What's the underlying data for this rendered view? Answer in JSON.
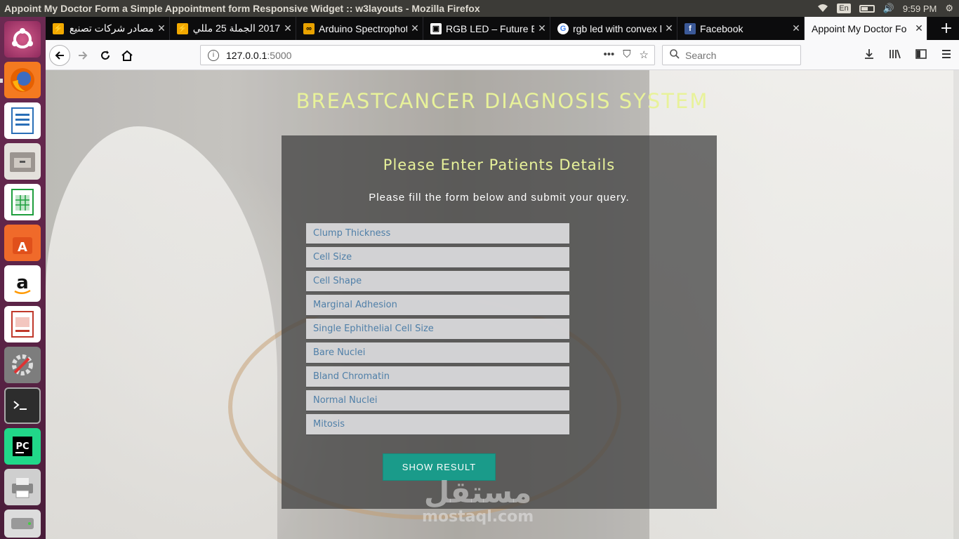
{
  "system": {
    "window_title": "Appoint My Doctor Form a Simple Appointment form Responsive Widget :: w3layouts - Mozilla Firefox",
    "keyboard": "En",
    "time": "9:59 PM"
  },
  "launcher": {
    "items": [
      "ubuntu-dash",
      "firefox",
      "writer",
      "files",
      "calc",
      "software-center",
      "amazon",
      "impress",
      "system-settings",
      "terminal",
      "pycharm",
      "printer",
      "drive"
    ]
  },
  "tabs": [
    {
      "label": "مصادر شركات تصنيع",
      "icon": "w3layouts-icon"
    },
    {
      "label": "2017 الجملة 25 مللي",
      "icon": "w3layouts-icon"
    },
    {
      "label": "Arduino Spectrophoto",
      "icon": "arduino-icon"
    },
    {
      "label": "RGB LED – Future Ele",
      "icon": "future-icon"
    },
    {
      "label": "rgb led with convex le",
      "icon": "google-icon"
    },
    {
      "label": "Facebook",
      "icon": "facebook-icon"
    },
    {
      "label": "Appoint My Doctor Fo",
      "icon": "",
      "active": true
    }
  ],
  "navbar": {
    "url_host": "127.0.0.1",
    "url_port": ":5000",
    "search_placeholder": "Search"
  },
  "page": {
    "title": "BREASTCANCER DIAGNOSIS SYSTEM",
    "form_title": "Please Enter Patients Details",
    "form_subtitle": "Please fill the form below and submit your query.",
    "fields": [
      "Clump Thickness",
      "Cell Size",
      "Cell Shape",
      "Marginal Adhesion",
      "Single Ephithelial Cell Size",
      "Bare Nuclei",
      "Bland Chromatin",
      "Normal Nuclei",
      "Mitosis"
    ],
    "submit_label": "SHOW RESULT",
    "watermark_ar": "مستقل",
    "watermark_lat": "mostaql.com"
  }
}
